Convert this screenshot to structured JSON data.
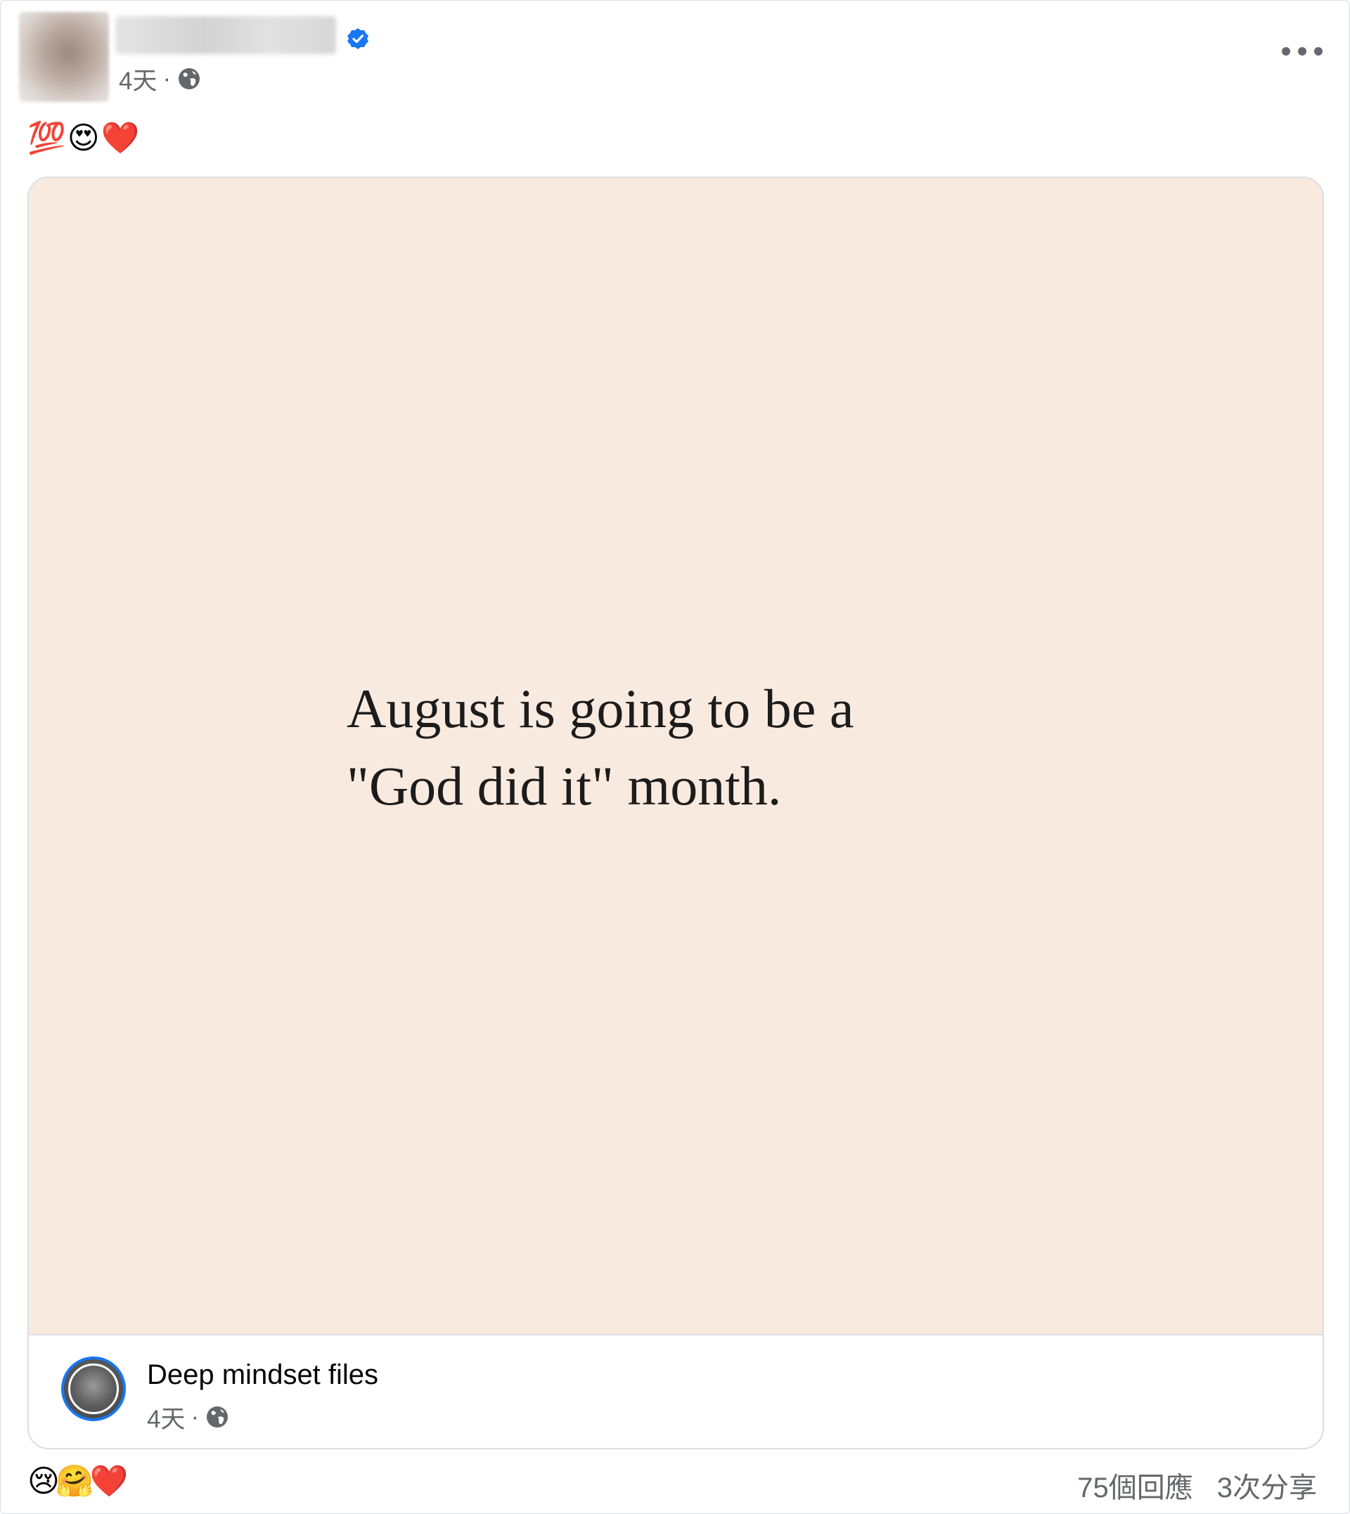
{
  "post": {
    "author_name": "",
    "timestamp": "4天",
    "separator": "·",
    "caption_emojis": "💯😍❤️",
    "more_label": "•••"
  },
  "shared_post": {
    "quote_line1": "August is going to be a",
    "quote_line2": "\"God did it\" month.",
    "page_name": "Deep mindset files",
    "page_timestamp": "4天",
    "separator": "·"
  },
  "footer": {
    "reaction_emojis": "😢🤗❤️",
    "reactions_count": "75個回應",
    "shares_count": "3次分享"
  },
  "colors": {
    "verified_badge": "#1877f2",
    "quote_background": "#f9eadf",
    "secondary_text": "#65676b"
  },
  "icons": [
    "verified-badge-icon",
    "globe-icon",
    "more-options-icon"
  ]
}
